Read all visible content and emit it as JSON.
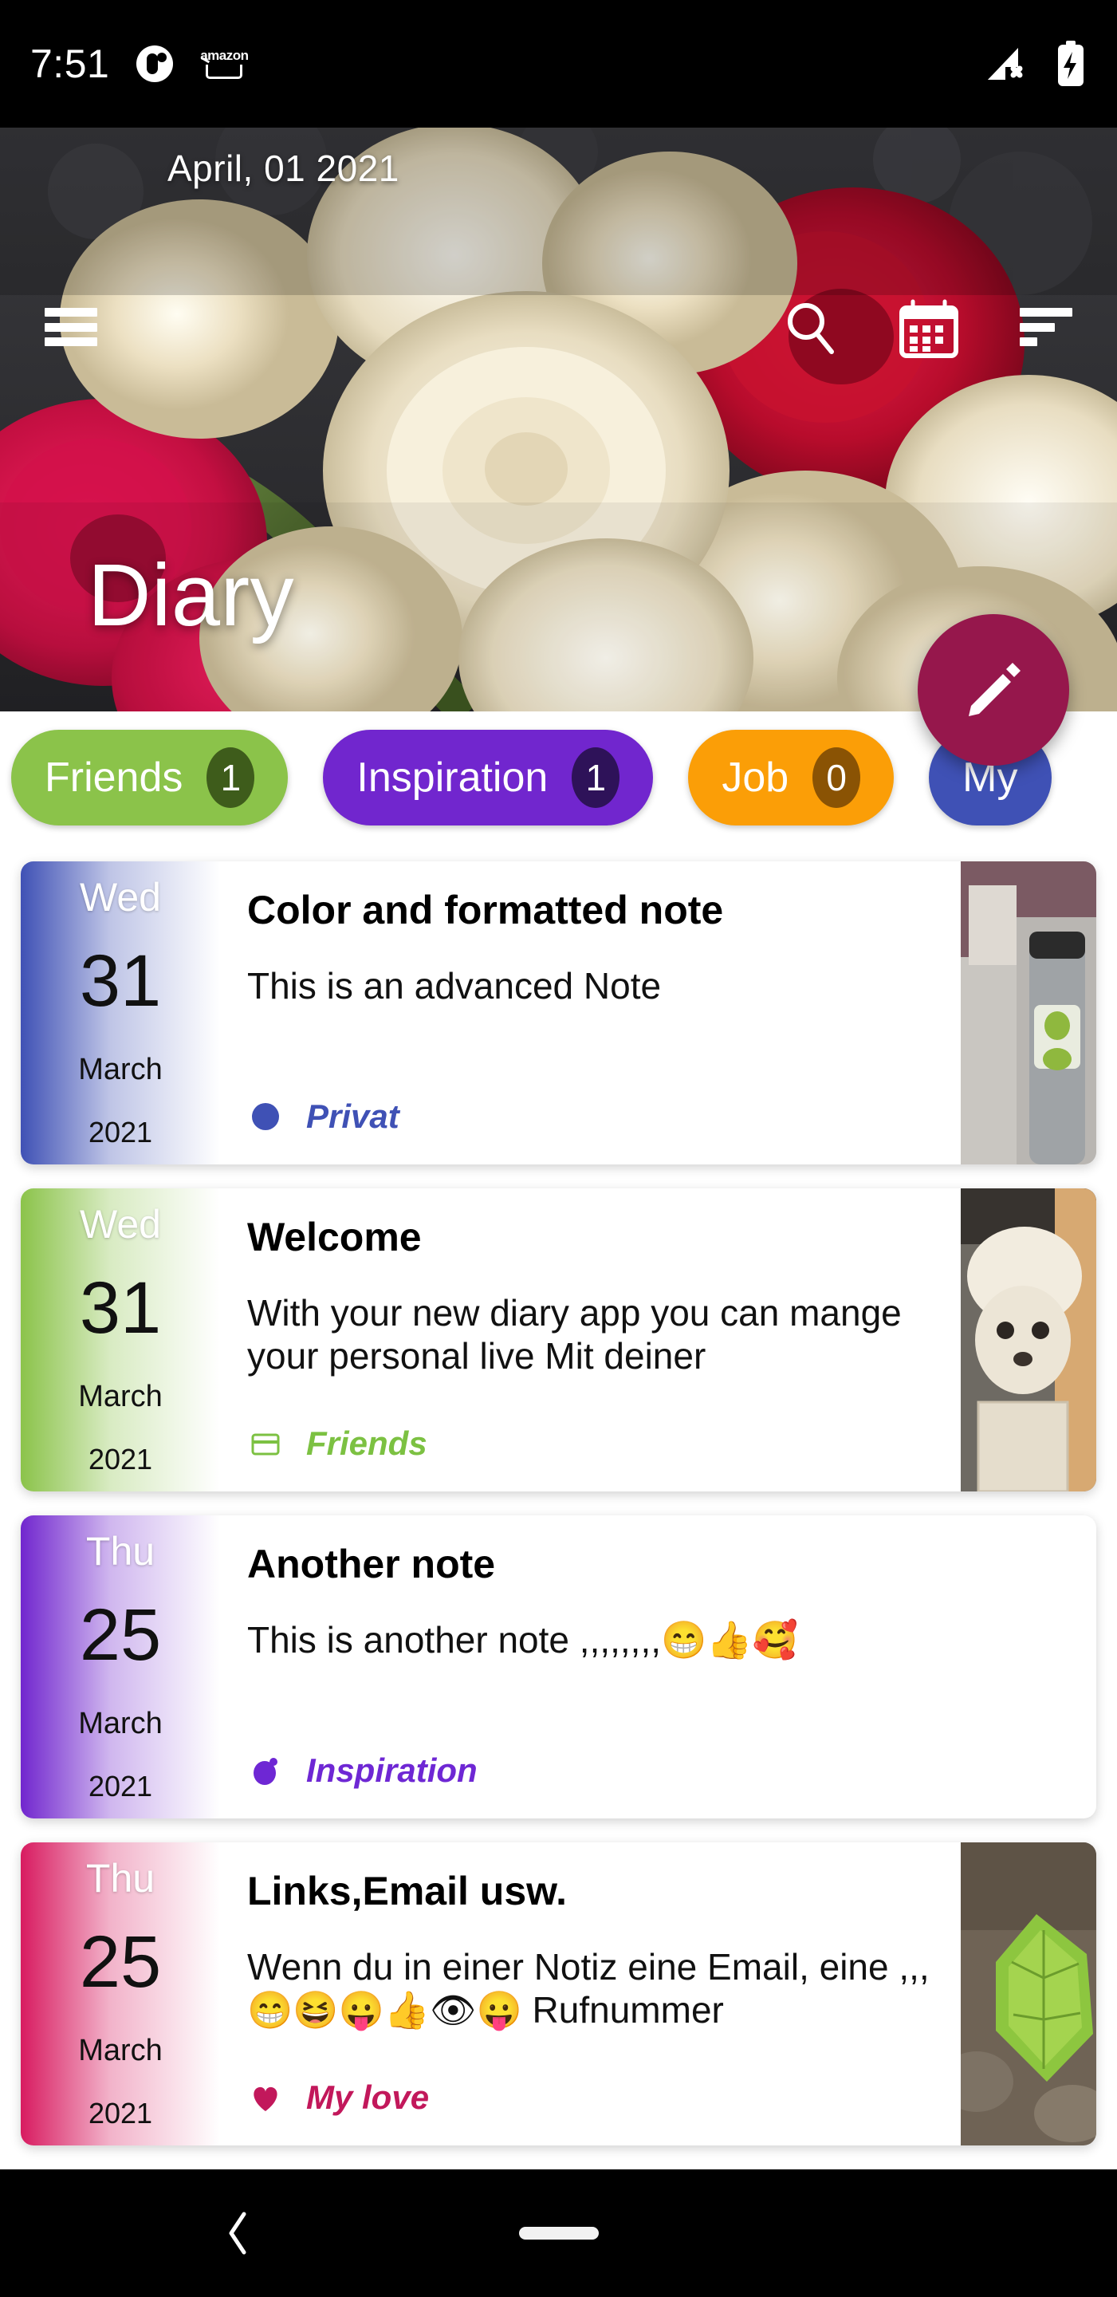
{
  "status_bar": {
    "time": "7:51",
    "left_icons": [
      "circle-app-icon",
      "amazon-icon"
    ],
    "amazon_label": "amazon",
    "right_icons": [
      "signal-no-service-icon",
      "battery-charging-icon"
    ]
  },
  "header": {
    "date": "April, 01 2021",
    "title": "Diary",
    "menu_icon": "hamburger-menu-icon",
    "search_icon": "search-icon",
    "calendar_icon": "calendar-icon",
    "sort_icon": "sort-icon"
  },
  "fab": {
    "icon": "pencil-edit-icon",
    "color": "#96174C"
  },
  "chips": [
    {
      "label": "Friends",
      "count": "1",
      "color": "#8BC34A",
      "count_color": "#3E5C1B",
      "text_color": "#ffffff"
    },
    {
      "label": "Inspiration",
      "count": "1",
      "color": "#7126CE",
      "count_color": "#2E1259",
      "text_color": "#ffffff"
    },
    {
      "label": "Job",
      "count": "0",
      "color": "#FB9E07",
      "count_color": "#8A5304",
      "text_color": "#ffffff"
    },
    {
      "label": "My",
      "count": "",
      "color": "#3F51B5",
      "count_color": "#1E2A66",
      "text_color": "#ffffff"
    }
  ],
  "notes": [
    {
      "dow": "Wed",
      "day": "31",
      "month": "March",
      "year": "2021",
      "title": "Color and formatted note",
      "text": "This is an advanced Note",
      "tag": "Privat",
      "tag_color": "#3F51B5",
      "tag_icon": "circle-icon",
      "stripe_color": "#3F51B5",
      "thumb": "bottle-photo",
      "has_thumb": true
    },
    {
      "dow": "Wed",
      "day": "31",
      "month": "March",
      "year": "2021",
      "title": "Welcome",
      "text": "With your new diary app you can mange your personal live Mit deiner",
      "tag": "Friends",
      "tag_color": "#7CC142",
      "tag_icon": "card-icon",
      "stripe_color": "#8BC34A",
      "thumb": "dog-photo",
      "has_thumb": true
    },
    {
      "dow": "Thu",
      "day": "25",
      "month": "March",
      "year": "2021",
      "title": "Another note",
      "text": "This is another note ,,,,,,,,😁👍🥰",
      "tag": "Inspiration",
      "tag_color": "#6E27D4",
      "tag_icon": "bulb-icon",
      "stripe_color": "#7126CE",
      "thumb": "",
      "has_thumb": false
    },
    {
      "dow": "Thu",
      "day": "25",
      "month": "March",
      "year": "2021",
      "title": "Links,Email usw.",
      "text": "Wenn du in einer Notiz eine Email, eine ,,,😁😆😛👍👁😛 Rufnummer",
      "tag": "My love",
      "tag_color": "#C2185B",
      "tag_icon": "heart-icon",
      "stripe_color": "#D81B60",
      "thumb": "leaf-photo",
      "has_thumb": true
    }
  ],
  "nav_bar": {
    "back_icon": "back-chevron-icon",
    "home_icon": "home-pill-icon"
  }
}
